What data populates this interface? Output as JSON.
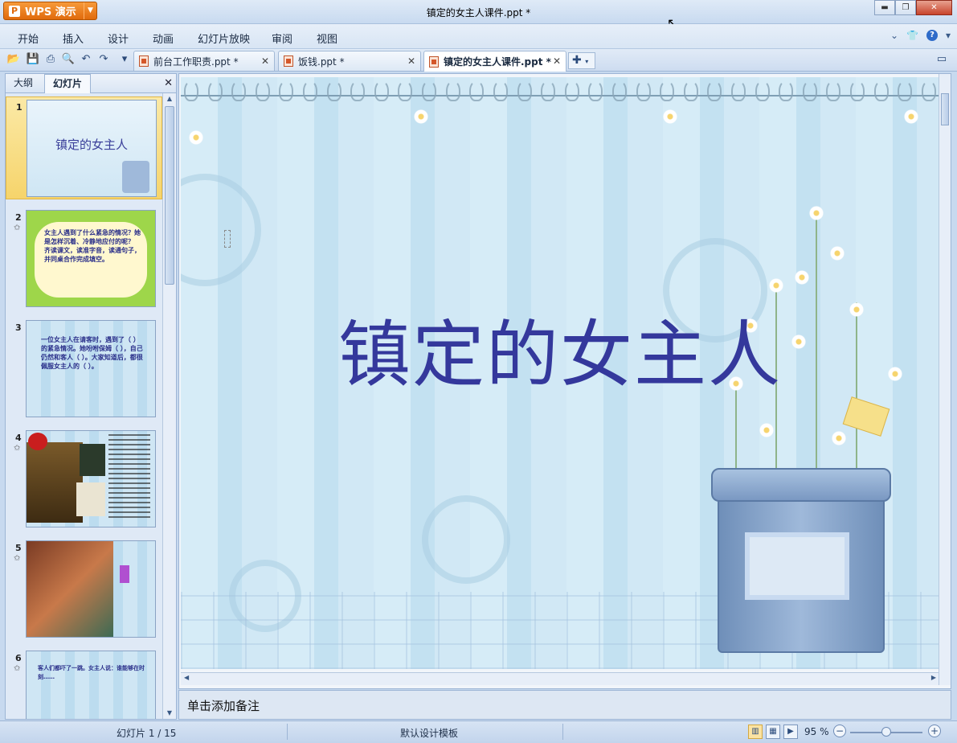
{
  "titlebar": {
    "app_button": "WPS 演示",
    "title": "镇定的女主人课件.ppt *"
  },
  "menu": [
    "开始",
    "插入",
    "设计",
    "动画",
    "幻灯片放映",
    "审阅",
    "视图"
  ],
  "tabs": [
    {
      "label": "前台工作职责.ppt *"
    },
    {
      "label": "饭钱.ppt *"
    },
    {
      "label": "镇定的女主人课件.ppt *"
    }
  ],
  "left_pane": {
    "tab_outline": "大纲",
    "tab_slides": "幻灯片",
    "thumbnails": [
      {
        "num": "1",
        "title": "镇定的女主人"
      },
      {
        "num": "2",
        "text": "女主人遇到了什么紧急的情况？她是怎样沉着、冷静地应付的呢？ 齐读课文，读准字音，读通句子，并同桌合作完成填空。"
      },
      {
        "num": "3",
        "text": "一位女主人在请客时，遇到了（ ）的紧急情况。她吩咐保姆（ ），自己仍然和客人（ ）。大家知道后，都很佩服女主人的（ ）。"
      },
      {
        "num": "4"
      },
      {
        "num": "5"
      },
      {
        "num": "6",
        "text": "客人们都吓了一跳。女主人说：谁能够在时刻……"
      }
    ]
  },
  "slide": {
    "title": "镇定的女主人"
  },
  "notes_placeholder": "单击添加备注",
  "status": {
    "slide_indicator": "幻灯片 1 / 15",
    "template": "默认设计模板",
    "zoom": "95 %",
    "zoom_fraction": 0.5
  },
  "colors": {
    "title_color": "#34389c",
    "app_button": "#e06a0c",
    "selected_thumb": "#f6d46b"
  }
}
